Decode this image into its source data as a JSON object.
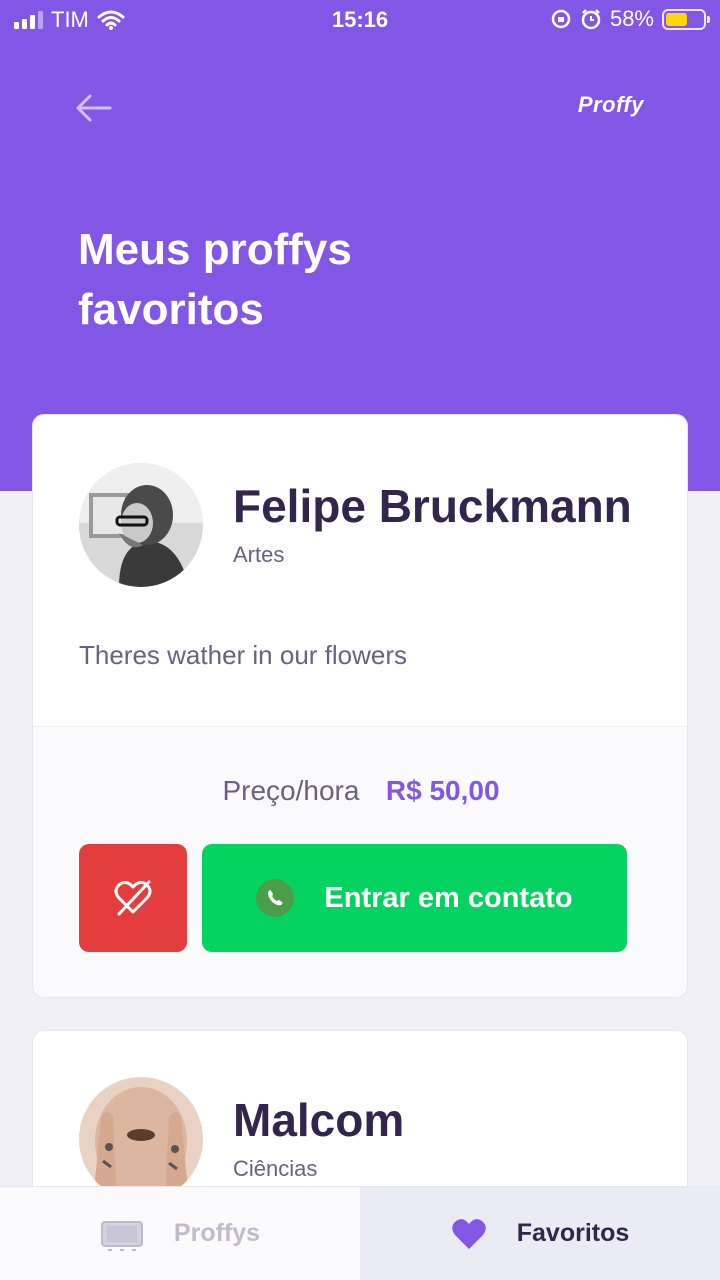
{
  "status_bar": {
    "carrier": "TIM",
    "time": "15:16",
    "battery_percent": "58%",
    "battery_level": 0.58,
    "battery_color": "#ffd60a"
  },
  "header": {
    "brand": "Proffy",
    "title": "Meus proffys favoritos",
    "background_color": "#8257e5"
  },
  "teachers": [
    {
      "name": "Felipe Bruckmann",
      "subject": "Artes",
      "bio": "Theres wather in our flowers",
      "price_label": "Preço/hora",
      "price": "R$ 50,00",
      "contact_label": "Entrar em contato"
    },
    {
      "name": "Malcom",
      "subject": "Ciências"
    }
  ],
  "tab_bar": {
    "proffys_label": "Proffys",
    "favorites_label": "Favoritos",
    "active_tab": "Favoritos"
  },
  "colors": {
    "accent": "#8257e5",
    "unfavorite": "#e33d3d",
    "contact": "#04d361"
  }
}
